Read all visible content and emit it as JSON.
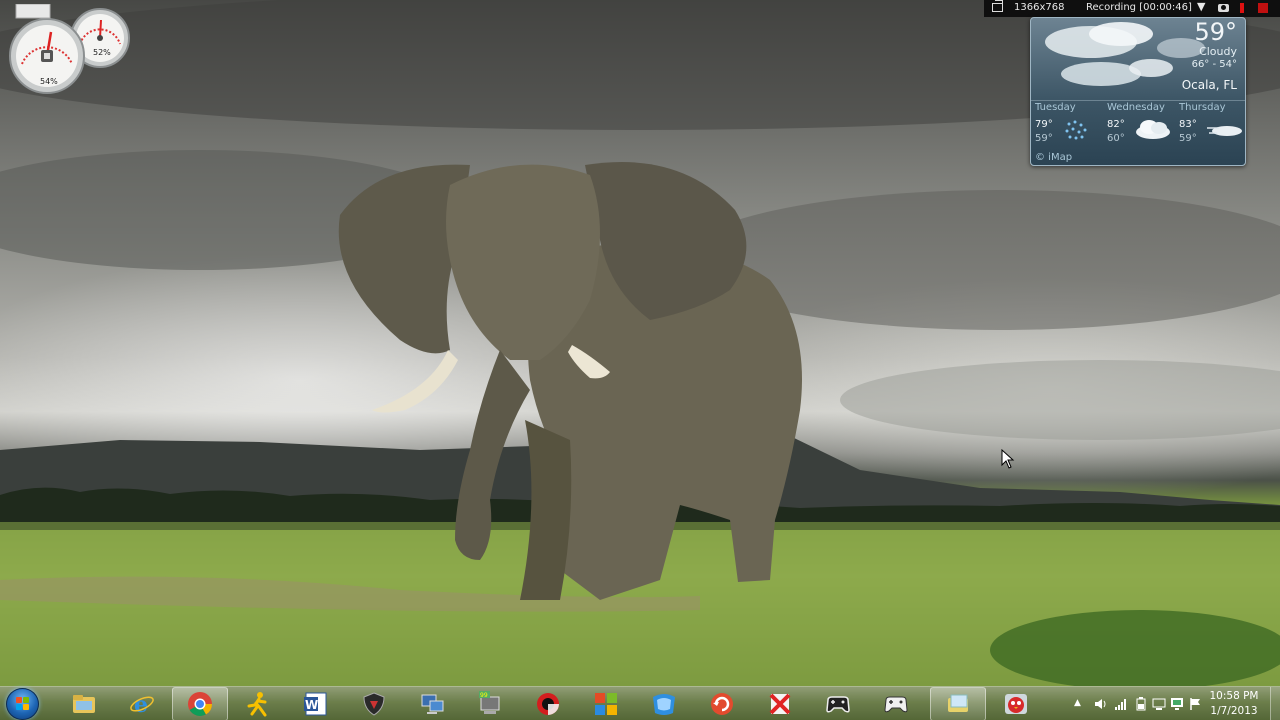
{
  "recording_bar": {
    "resolution": "1366x768",
    "status": "Recording [00:00:46]",
    "dropdown_glyph": "▼"
  },
  "meter_gadget": {
    "cpu_percent": 54,
    "memory_percent": 52,
    "cpu_label": "54%",
    "memory_label": "52%"
  },
  "weather": {
    "temperature": "59°",
    "condition": "Cloudy",
    "range": "66° - 54°",
    "city": "Ocala, FL",
    "credit": "© iMap",
    "forecast": [
      {
        "day": "Tuesday",
        "high": "79°",
        "low": "59°",
        "icon": "rain-icon"
      },
      {
        "day": "Wednesday",
        "high": "82°",
        "low": "60°",
        "icon": "cloud-icon"
      },
      {
        "day": "Thursday",
        "high": "83°",
        "low": "59°",
        "icon": "windy-cloud-icon"
      }
    ]
  },
  "taskbar": {
    "start": "start-orb",
    "pinned": [
      {
        "name": "windows-explorer",
        "active": false
      },
      {
        "name": "internet-explorer",
        "active": false
      },
      {
        "name": "google-chrome",
        "active": true
      },
      {
        "name": "aim",
        "active": false
      },
      {
        "name": "microsoft-word",
        "active": false
      },
      {
        "name": "shield-app",
        "active": false
      },
      {
        "name": "network-computer",
        "active": false
      },
      {
        "name": "computer-99",
        "active": false
      },
      {
        "name": "record-app",
        "active": false
      },
      {
        "name": "windows-tiles",
        "active": false
      },
      {
        "name": "windows-live",
        "active": false
      },
      {
        "name": "refresh-app",
        "active": false
      },
      {
        "name": "x-app",
        "active": false
      },
      {
        "name": "game-controller",
        "active": false
      },
      {
        "name": "gamepad",
        "active": false
      },
      {
        "name": "folder-window",
        "active": true
      },
      {
        "name": "angry-birds",
        "active": false
      }
    ],
    "tray_overflow": "▲",
    "time": "10:58 PM",
    "date": "1/7/2013"
  },
  "colors": {
    "taskbar": "#6c8048",
    "weather_panel": "#3d5666",
    "recording_stop": "#c01010"
  }
}
